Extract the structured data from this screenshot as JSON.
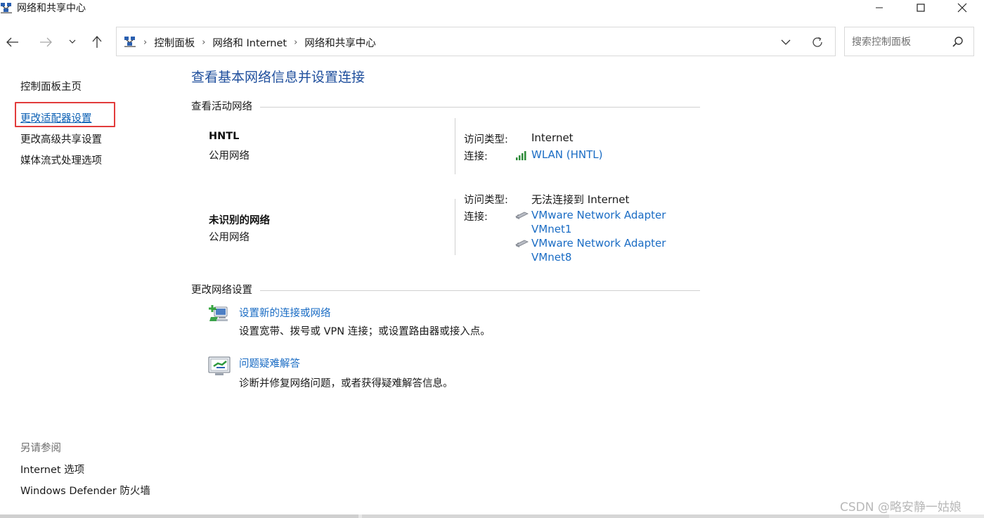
{
  "window": {
    "title": "网络和共享中心"
  },
  "address": {
    "crumbs": [
      "控制面板",
      "网络和 Internet",
      "网络和共享中心"
    ]
  },
  "search": {
    "placeholder": "搜索控制面板"
  },
  "leftpane": {
    "home": "控制面板主页",
    "links": [
      "更改适配器设置",
      "更改高级共享设置",
      "媒体流式处理选项"
    ],
    "see_also_title": "另请参阅",
    "see_also": [
      "Internet 选项",
      "Windows Defender 防火墙"
    ]
  },
  "main": {
    "title": "查看基本网络信息并设置连接",
    "active_networks_header": "查看活动网络",
    "networks": [
      {
        "name": "HNTL",
        "type": "公用网络",
        "access_label": "访问类型:",
        "access_value": "Internet",
        "connection_label": "连接:",
        "connections": [
          "WLAN (HNTL)"
        ]
      },
      {
        "name": "未识别的网络",
        "type": "公用网络",
        "access_label": "访问类型:",
        "access_value": "无法连接到 Internet",
        "connection_label": "连接:",
        "connections": [
          {
            "line1": "VMware Network Adapter",
            "line2": "VMnet1"
          },
          {
            "line1": "VMware Network Adapter",
            "line2": "VMnet8"
          }
        ]
      }
    ],
    "change_settings_header": "更改网络设置",
    "tasks": [
      {
        "title": "设置新的连接或网络",
        "desc": "设置宽带、拨号或 VPN 连接；或设置路由器或接入点。"
      },
      {
        "title": "问题疑难解答",
        "desc": "诊断并修复网络问题，或者获得疑难解答信息。"
      }
    ]
  },
  "watermark": "CSDN @略安静一姑娘",
  "colors": {
    "link": "#1a6cc4",
    "title": "#1e4e9c",
    "highlight": "#e23b3b"
  }
}
